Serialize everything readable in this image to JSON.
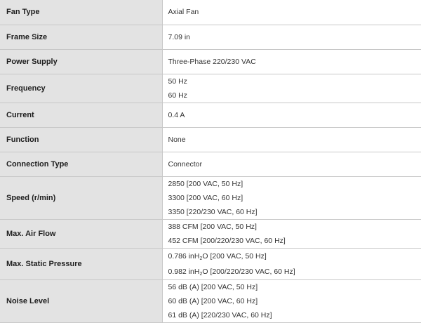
{
  "specs": [
    {
      "label": "Fan Type",
      "values": [
        "Axial Fan"
      ]
    },
    {
      "label": "Frame Size",
      "values": [
        "7.09 in"
      ]
    },
    {
      "label": "Power Supply",
      "values": [
        "Three-Phase 220/230 VAC"
      ]
    },
    {
      "label": "Frequency",
      "values": [
        "50 Hz",
        "60 Hz"
      ]
    },
    {
      "label": "Current",
      "values": [
        "0.4 A"
      ]
    },
    {
      "label": "Function",
      "values": [
        "None"
      ]
    },
    {
      "label": "Connection Type",
      "values": [
        "Connector"
      ]
    },
    {
      "label": "Speed (r/min)",
      "values": [
        "2850 [200 VAC, 50 Hz]",
        "3300 [200 VAC, 60 Hz]",
        "3350 [220/230 VAC, 60 Hz]"
      ]
    },
    {
      "label": "Max. Air Flow",
      "values": [
        "388 CFM [200 VAC, 50 Hz]",
        "452 CFM [200/220/230 VAC, 60 Hz]"
      ]
    },
    {
      "label": "Max. Static Pressure",
      "pressure": [
        {
          "value": "0.786 inH",
          "sub": "2",
          "unit": "O",
          "cond": " [200 VAC, 50 Hz]"
        },
        {
          "value": "0.982 inH",
          "sub": "2",
          "unit": "O",
          "cond": " [200/220/230 VAC, 60 Hz]"
        }
      ]
    },
    {
      "label": "Noise Level",
      "values": [
        "56 dB (A) [200 VAC, 50 Hz]",
        "60 dB (A) [200 VAC, 60 Hz]",
        "61 dB (A) [220/230 VAC, 60 Hz]"
      ]
    }
  ]
}
